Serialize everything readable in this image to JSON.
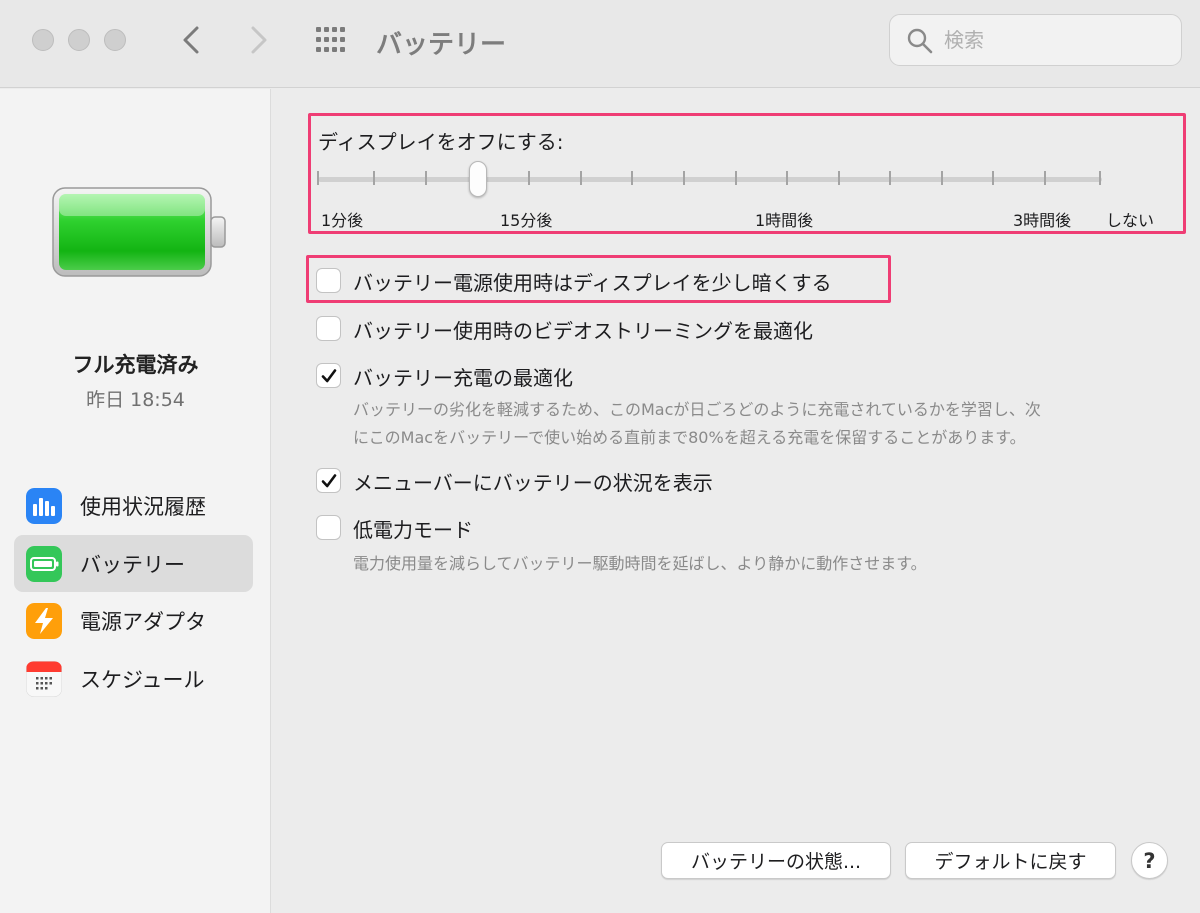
{
  "window": {
    "title": "バッテリー",
    "search_placeholder": "検索"
  },
  "sidebar": {
    "status_title": "フル充電済み",
    "status_time": "昨日 18:54",
    "battery_level_fraction": 1.0,
    "items": [
      {
        "label": "使用状況履歴",
        "icon": "bar-chart-icon",
        "selected": false
      },
      {
        "label": "バッテリー",
        "icon": "battery-icon",
        "selected": true
      },
      {
        "label": "電源アダプタ",
        "icon": "lightning-icon",
        "selected": false
      },
      {
        "label": "スケジュール",
        "icon": "calendar-icon",
        "selected": false
      }
    ]
  },
  "display_off": {
    "label": "ディスプレイをオフにする:",
    "tick_labels": [
      "1分後",
      "15分後",
      "1時間後",
      "3時間後",
      "しない"
    ],
    "value_label": "15分後"
  },
  "options": [
    {
      "label": "バッテリー電源使用時はディスプレイを少し暗くする",
      "checked": false
    },
    {
      "label": "バッテリー使用時のビデオストリーミングを最適化",
      "checked": false
    },
    {
      "label": "バッテリー充電の最適化",
      "checked": true,
      "description": [
        "バッテリーの劣化を軽減するため、このMacが日ごろどのように充電されているかを学習し、次",
        "にこのMacをバッテリーで使い始める直前まで80%を超える充電を保留することがあります。"
      ]
    },
    {
      "label": "メニューバーにバッテリーの状況を表示",
      "checked": true
    },
    {
      "label": "低電力モード",
      "checked": false,
      "description": [
        "電力使用量を減らしてバッテリー駆動時間を延ばし、より静かに動作させます。"
      ]
    }
  ],
  "buttons": {
    "battery_health": "バッテリーの状態...",
    "restore_defaults": "デフォルトに戻す",
    "help": "?"
  },
  "colors": {
    "highlight": "#ef3d74",
    "battery_fill": "#2fd12f",
    "selection": "#dcdcdc"
  }
}
